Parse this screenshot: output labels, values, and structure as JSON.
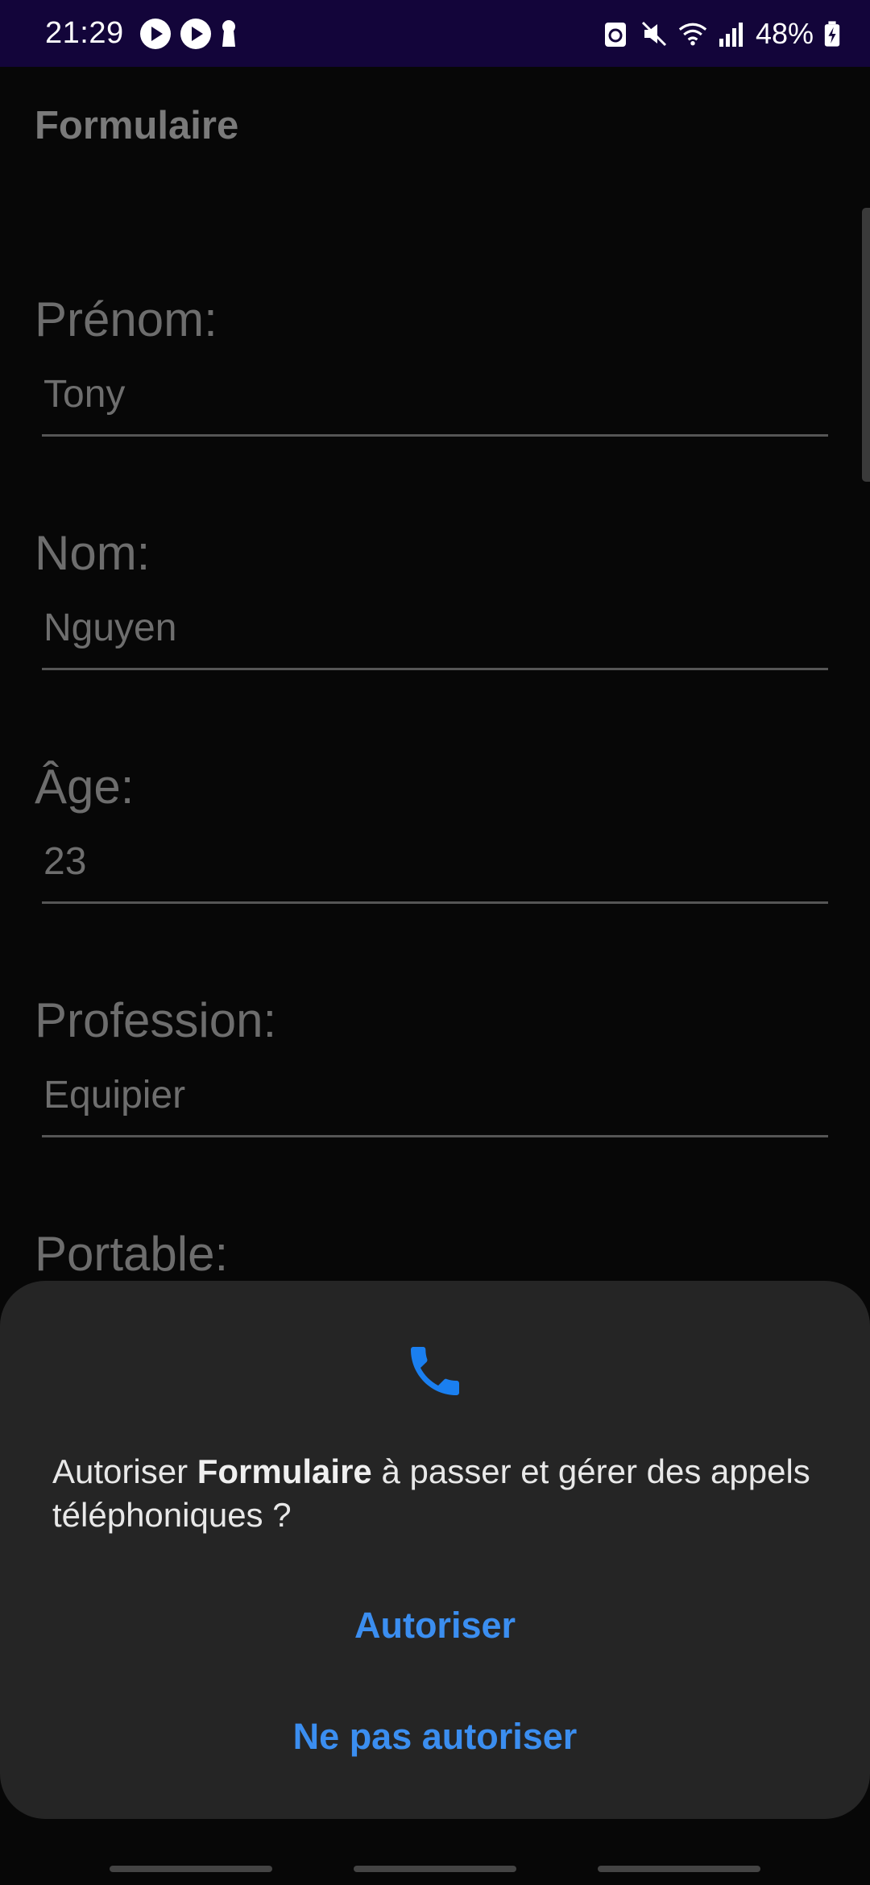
{
  "status_bar": {
    "time": "21:29",
    "battery": "48%",
    "icons": [
      "play-icon",
      "play-icon",
      "keyhole-icon",
      "recycle-icon",
      "mute-icon",
      "wifi-icon",
      "signal-icon",
      "battery-charging-icon"
    ]
  },
  "app": {
    "title": "Formulaire"
  },
  "form": {
    "fields": [
      {
        "label": "Prénom:",
        "value": "Tony"
      },
      {
        "label": "Nom:",
        "value": "Nguyen"
      },
      {
        "label": "Âge:",
        "value": "23"
      },
      {
        "label": "Profession:",
        "value": "Equipier"
      },
      {
        "label": "Portable:",
        "value": ""
      }
    ]
  },
  "permission_dialog": {
    "icon": "phone-icon",
    "prompt_prefix": "Autoriser ",
    "prompt_app": "Formulaire",
    "prompt_suffix": " à passer et gérer des appels téléphoniques ?",
    "allow_label": "Autoriser",
    "deny_label": "Ne pas autoriser"
  },
  "colors": {
    "status_bar_bg": "#13053a",
    "background": "#070707",
    "sheet_bg": "#252525",
    "accent": "#3b8ef0"
  }
}
